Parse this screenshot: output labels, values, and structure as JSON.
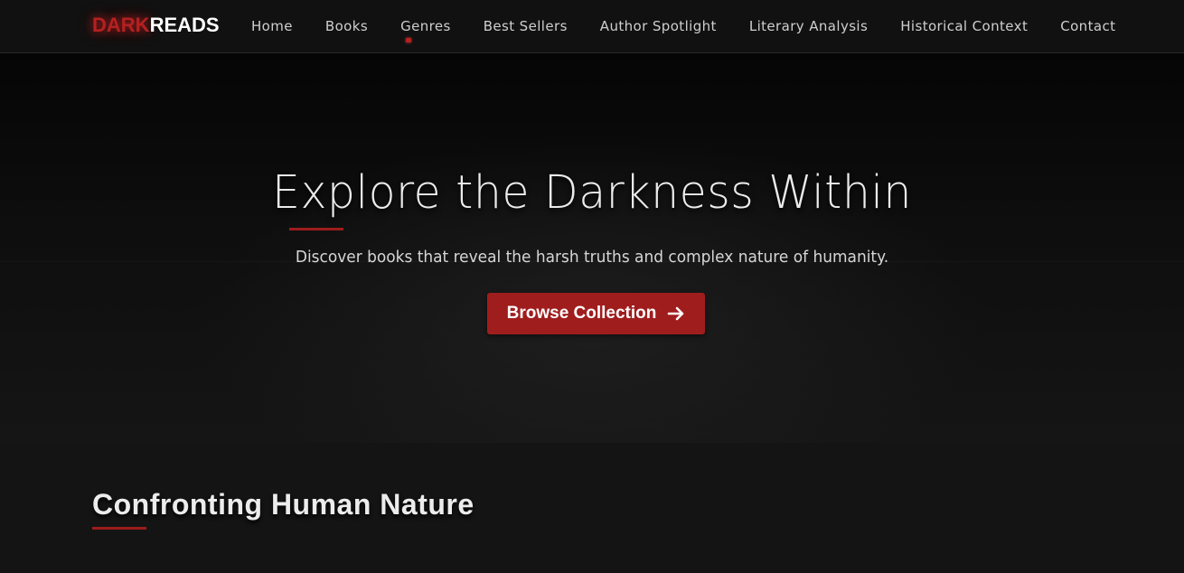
{
  "navbar": {
    "logo": {
      "part1": "DARK",
      "part2": "READS"
    },
    "links": [
      {
        "label": "Home"
      },
      {
        "label": "Books"
      },
      {
        "label": "Genres"
      },
      {
        "label": "Best Sellers"
      },
      {
        "label": "Author Spotlight"
      },
      {
        "label": "Literary Analysis"
      },
      {
        "label": "Historical Context"
      },
      {
        "label": "Contact"
      }
    ]
  },
  "hero": {
    "title": "Explore the Darkness Within",
    "subtitle": "Discover books that reveal the harsh truths and complex nature of humanity.",
    "cta_label": "Browse Collection",
    "cta_icon": "arrow-right-icon"
  },
  "section": {
    "title": "Confronting Human Nature"
  },
  "colors": {
    "accent": "#a01d1d",
    "background": "#121212",
    "text": "#e8e8e8"
  }
}
